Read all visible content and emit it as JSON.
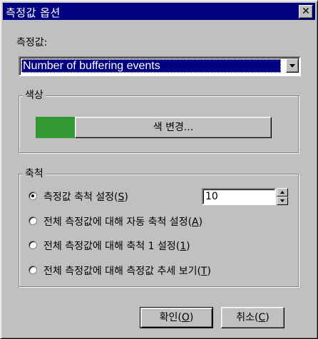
{
  "window": {
    "title": "측정값 옵션",
    "close_glyph": "✕"
  },
  "measure": {
    "label": "측정값:",
    "selected": "Number of buffering events"
  },
  "color_group": {
    "legend": "색상",
    "swatch_color": "#339933",
    "change_button": "색 변경..."
  },
  "scale_group": {
    "legend": "축척",
    "options": [
      {
        "text_before": "측정값 축척 설정(",
        "mnemonic": "S",
        "text_after": ")",
        "selected": true
      },
      {
        "text_before": "전체 측정값에 대해 자동 축척 설정(",
        "mnemonic": "A",
        "text_after": ")",
        "selected": false
      },
      {
        "text_before": "전체 측정값에 대해 축척 1 설정(",
        "mnemonic": "1",
        "text_after": ")",
        "selected": false
      },
      {
        "text_before": "전체 측정값에 대해 측정값 추세 보기(",
        "mnemonic": "T",
        "text_after": ")",
        "selected": false
      }
    ],
    "scale_value": "10"
  },
  "buttons": {
    "ok": {
      "text_before": "확인(",
      "mnemonic": "O",
      "text_after": ")"
    },
    "cancel": {
      "text_before": "취소(",
      "mnemonic": "C",
      "text_after": ")"
    }
  },
  "colors": {
    "title_bar": "#000080",
    "face": "#c0c0c0"
  }
}
